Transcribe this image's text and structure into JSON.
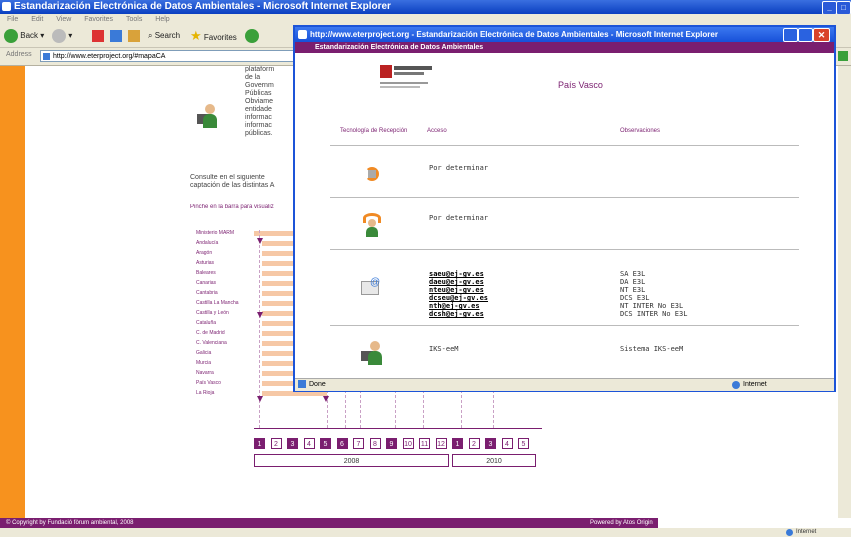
{
  "back_window": {
    "title": "Estandarización Electrónica de Datos Ambientales - Microsoft Internet Explorer",
    "menu": [
      "File",
      "Edit",
      "View",
      "Favorites",
      "Tools",
      "Help"
    ],
    "toolbar": {
      "back": "Back",
      "search": "Search",
      "favorites": "Favorites"
    },
    "address_label": "Address",
    "address_url": "http://www.eterproject.org/#mapaCA",
    "body_text_fragments": [
      "plataform",
      "de la",
      "Governm",
      "Públicas",
      "Obviame",
      "entidade",
      "informac",
      "informac",
      "públicas."
    ],
    "consulte_text_1": "Consulte en el siguiente",
    "consulte_text_2": "captación de las distintas A",
    "pinche_text": "Pinche en la barra para visualiz",
    "regions": [
      "Ministerio MARM",
      "Andalucía",
      "Aragón",
      "Asturias",
      "Baleares",
      "Canarias",
      "Cantabria",
      "Castilla La Mancha",
      "Castilla y León",
      "Cataluña",
      "C. de Madrid",
      "C. Valenciana",
      "Galicia",
      "Murcia",
      "Navarra",
      "País Vasco",
      "La Rioja"
    ],
    "months": [
      "1",
      "2",
      "3",
      "4",
      "5",
      "6",
      "7",
      "8",
      "9",
      "10",
      "11",
      "12",
      "1",
      "2",
      "3",
      "4",
      "5"
    ],
    "year_2008": "2008",
    "year_2010": "2010",
    "footer_left": "© Copyright by Fundació fòrum ambiental, 2008",
    "footer_right": "Powered by Atos Origin",
    "status_zone": "Internet"
  },
  "popup": {
    "title": "http://www.eterproject.org - Estandarización Electrónica de Datos Ambientales - Microsoft Internet Explorer",
    "subtitle": "Estandarización Electrónica de Datos Ambientales",
    "region_name": "País Vasco",
    "headers": {
      "tecnologia": "Tecnología de Recepción",
      "acceso": "Acceso",
      "observaciones": "Observaciones"
    },
    "rows": [
      {
        "icon": "sync-icon",
        "acceso": "Por determinar"
      },
      {
        "icon": "user-sync-icon",
        "acceso": "Por determinar"
      },
      {
        "icon": "email-icon",
        "emails": [
          "saeu@ej-gv.es",
          "daeu@ej-gv.es",
          "nteu@ej-gv.es",
          "dcseu@ej-gv.es",
          "nth@ej-gv.es",
          "dcsh@ej-gv.es"
        ],
        "observaciones": [
          "SA E3L",
          "DA E3L",
          "NT E3L",
          "DCS E3L",
          "NT INTER No E3L",
          "DCS INTER No E3L"
        ]
      },
      {
        "icon": "computer-user-icon",
        "acceso": "IKS-eeM",
        "observaciones": "Sistema IKS-eeM"
      }
    ],
    "status_left": "Done",
    "status_zone": "Internet"
  }
}
